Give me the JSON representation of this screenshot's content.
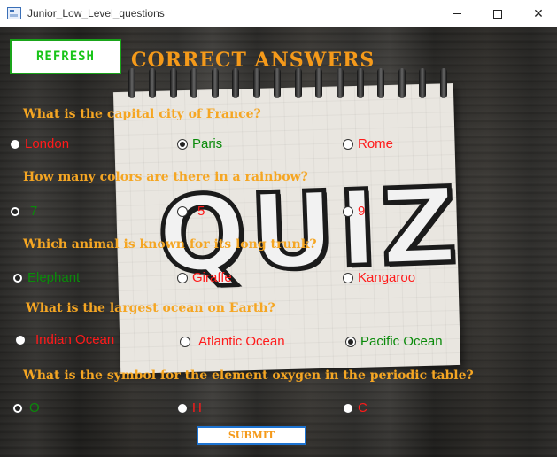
{
  "window": {
    "title": "Junior_Low_Level_questions",
    "controls": {
      "minimize": "minimize",
      "maximize": "maximize",
      "close": "✕"
    }
  },
  "header": {
    "refresh_label": "REFRESH",
    "correct_answers_label": "CORRECT ANSWERS"
  },
  "background": {
    "quiz_word": "QUIZ"
  },
  "questions": [
    {
      "text": "What is the capital city of France?",
      "options": [
        {
          "label": "London",
          "selected": false,
          "color": "#ff1a1a"
        },
        {
          "label": "Paris",
          "selected": true,
          "color": "#0a8a0a"
        },
        {
          "label": "Rome",
          "selected": false,
          "color": "#ff1a1a"
        }
      ]
    },
    {
      "text": "How many colors are there in a rainbow?",
      "options": [
        {
          "label": "7",
          "selected": true,
          "color": "#0a8a0a"
        },
        {
          "label": "5",
          "selected": false,
          "color": "#ff1a1a"
        },
        {
          "label": "9",
          "selected": false,
          "color": "#ff1a1a"
        }
      ]
    },
    {
      "text": "Which animal is known for its long trunk?",
      "options": [
        {
          "label": "Elephant",
          "selected": true,
          "color": "#0a8a0a"
        },
        {
          "label": "Giraffe",
          "selected": false,
          "color": "#ff1a1a"
        },
        {
          "label": "Kangaroo",
          "selected": false,
          "color": "#ff1a1a"
        }
      ]
    },
    {
      "text": "What is the largest ocean on Earth?",
      "options": [
        {
          "label": "Indian Ocean",
          "selected": false,
          "color": "#ff1a1a"
        },
        {
          "label": "Atlantic Ocean",
          "selected": false,
          "color": "#ff1a1a"
        },
        {
          "label": "Pacific Ocean",
          "selected": true,
          "color": "#0a8a0a"
        }
      ]
    },
    {
      "text": "What is the symbol for the element oxygen in the periodic table?",
      "options": [
        {
          "label": "O",
          "selected": true,
          "color": "#0a8a0a"
        },
        {
          "label": "H",
          "selected": false,
          "color": "#ff1a1a"
        },
        {
          "label": "C",
          "selected": false,
          "color": "#ff1a1a"
        }
      ]
    }
  ],
  "footer": {
    "submit_label": "SUBMIT"
  },
  "colors": {
    "question_text": "#f5a623",
    "refresh_text": "#18c418",
    "correct_option": "#0a8a0a",
    "wrong_option": "#ff1a1a",
    "submit_border": "#1e74d2"
  }
}
